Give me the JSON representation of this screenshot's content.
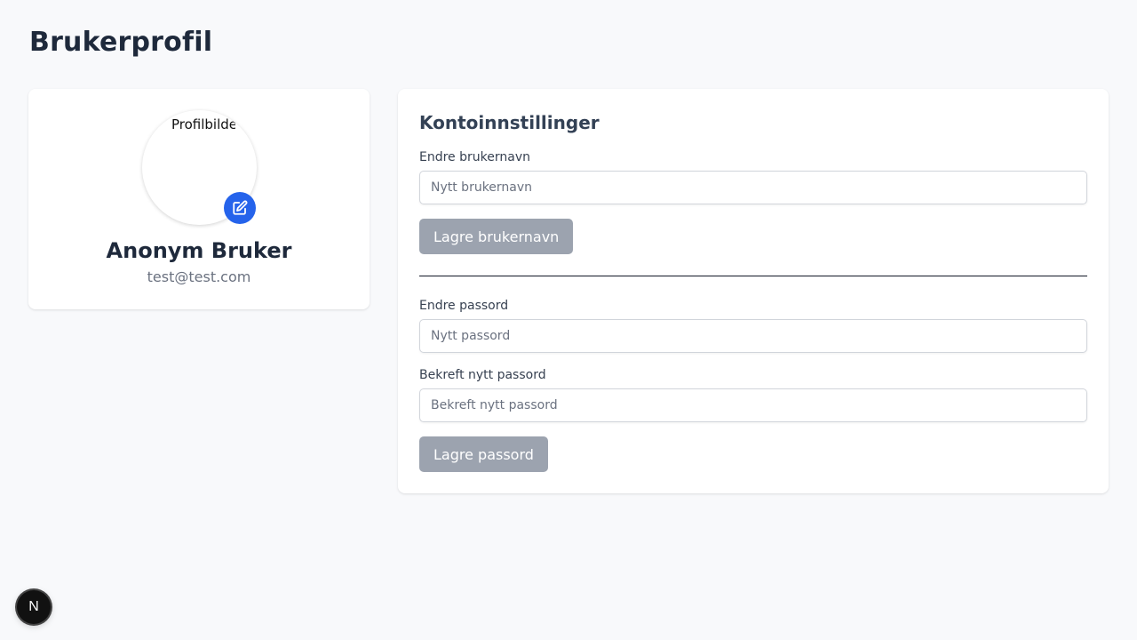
{
  "page": {
    "title": "Brukerprofil"
  },
  "profile": {
    "avatar_alt": "Profilbilde",
    "name": "Anonym Bruker",
    "email": "test@test.com",
    "edit_icon": "edit-square-pencil-icon"
  },
  "settings": {
    "title": "Kontoinnstillinger",
    "username": {
      "label": "Endre brukernavn",
      "placeholder": "Nytt brukernavn",
      "value": "",
      "button": "Lagre brukernavn"
    },
    "password": {
      "label": "Endre passord",
      "placeholder": "Nytt passord",
      "value": "",
      "confirm_label": "Bekreft nytt passord",
      "confirm_placeholder": "Bekreft nytt passord",
      "confirm_value": "",
      "button": "Lagre passord"
    }
  },
  "dev_badge": {
    "letter": "N"
  },
  "colors": {
    "accent": "#2563eb",
    "disabled_button": "#9ca3af",
    "background": "#f8f9fb"
  }
}
